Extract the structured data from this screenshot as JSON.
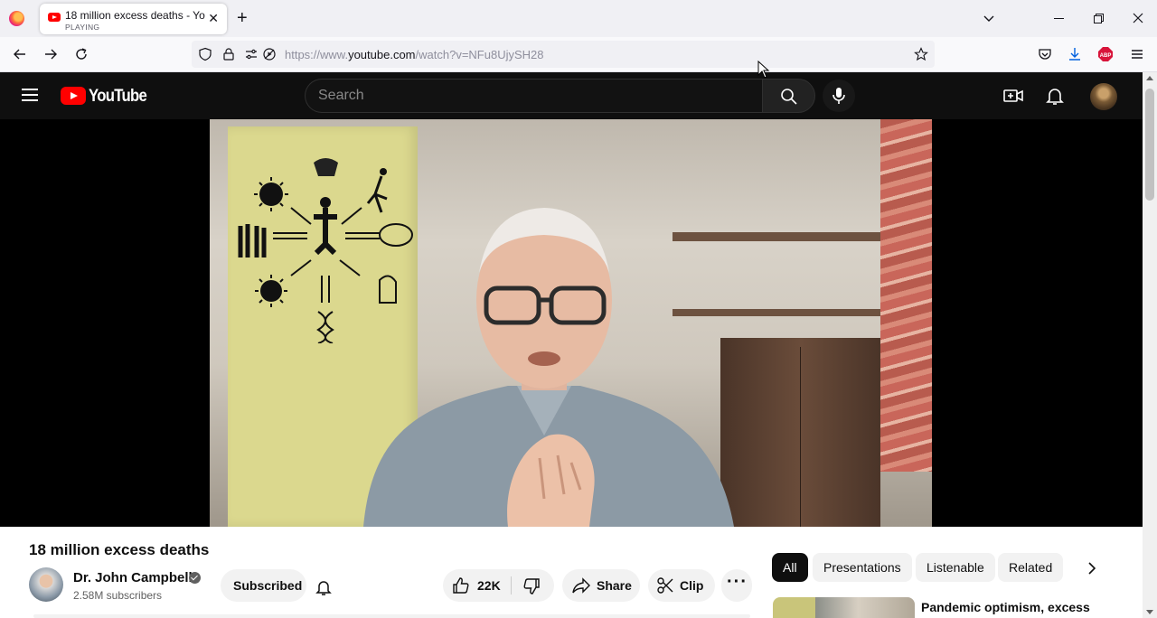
{
  "browser": {
    "tab": {
      "title": "18 million excess deaths - YouTube",
      "status": "PLAYING"
    },
    "address": {
      "prefix": "https://www.",
      "domain": "youtube.com",
      "path": "/watch?v=NFu8UjySH28"
    },
    "extension_badge": "6"
  },
  "youtube": {
    "logo_text": "YouTube",
    "search": {
      "placeholder": "Search"
    },
    "video": {
      "title": "18 million excess deaths",
      "channel": "Dr. John Campbell",
      "subscribers": "2.58M subscribers",
      "subscribe_label": "Subscribed",
      "likes": "22K",
      "share_label": "Share",
      "clip_label": "Clip"
    },
    "chips": [
      "All",
      "Presentations",
      "Listenable",
      "Related"
    ],
    "related": [
      {
        "title": "Pandemic optimism, excess"
      }
    ]
  },
  "colors": {
    "brand": "#ff0000",
    "header_bg": "#0f0f0f",
    "chip_active": "#0f0f0f"
  }
}
